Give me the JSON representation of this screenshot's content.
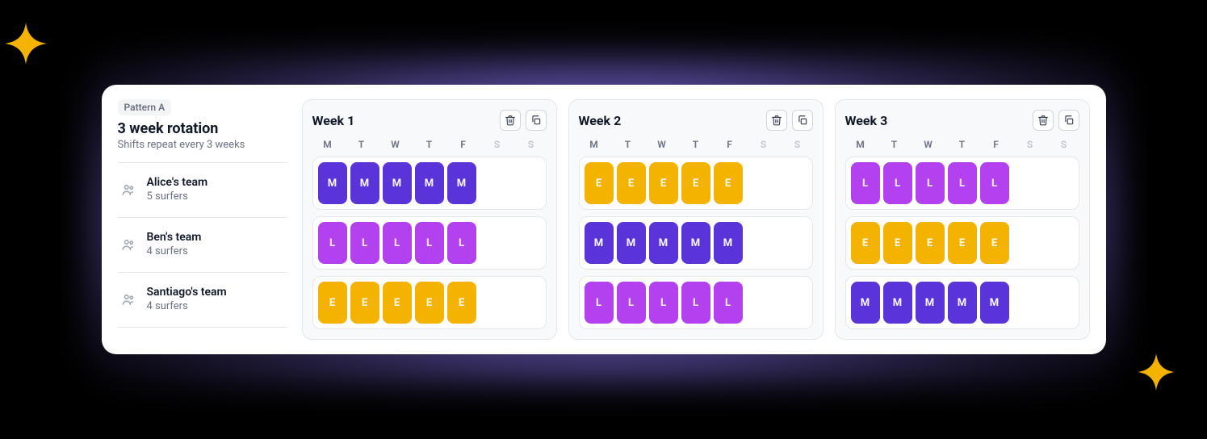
{
  "pattern": {
    "badge": "Pattern A",
    "title": "3 week rotation",
    "subtitle": "Shifts repeat every 3 weeks"
  },
  "teams": [
    {
      "name": "Alice's team",
      "sub": "5 surfers"
    },
    {
      "name": "Ben's team",
      "sub": "4 surfers"
    },
    {
      "name": "Santiago's team",
      "sub": "4 surfers"
    }
  ],
  "day_labels": [
    "M",
    "T",
    "W",
    "T",
    "F",
    "S",
    "S"
  ],
  "weeks": [
    {
      "title": "Week 1",
      "rows": [
        [
          "M",
          "M",
          "M",
          "M",
          "M",
          "",
          ""
        ],
        [
          "L",
          "L",
          "L",
          "L",
          "L",
          "",
          ""
        ],
        [
          "E",
          "E",
          "E",
          "E",
          "E",
          "",
          ""
        ]
      ]
    },
    {
      "title": "Week 2",
      "rows": [
        [
          "E",
          "E",
          "E",
          "E",
          "E",
          "",
          ""
        ],
        [
          "M",
          "M",
          "M",
          "M",
          "M",
          "",
          ""
        ],
        [
          "L",
          "L",
          "L",
          "L",
          "L",
          "",
          ""
        ]
      ]
    },
    {
      "title": "Week 3",
      "rows": [
        [
          "L",
          "L",
          "L",
          "L",
          "L",
          "",
          ""
        ],
        [
          "E",
          "E",
          "E",
          "E",
          "E",
          "",
          ""
        ],
        [
          "M",
          "M",
          "M",
          "M",
          "M",
          "",
          ""
        ]
      ]
    }
  ],
  "shift_colors": {
    "M": "#5B34D9",
    "L": "#B341F0",
    "E": "#F5B301"
  }
}
